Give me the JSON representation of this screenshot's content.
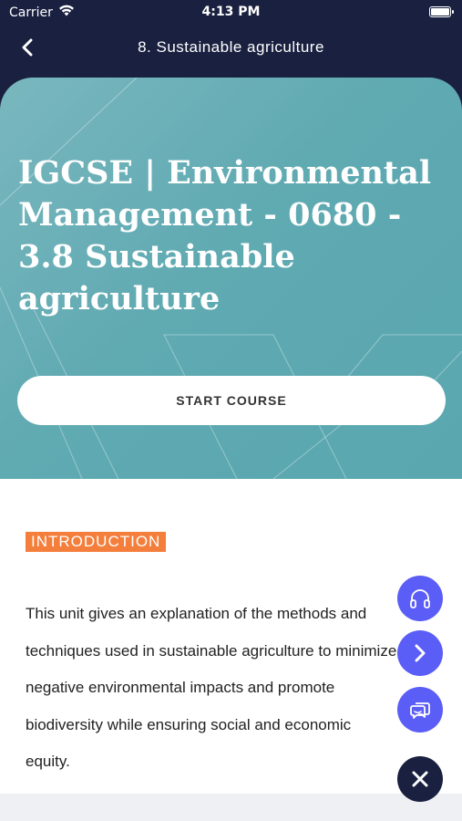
{
  "status_bar": {
    "carrier": "Carrier",
    "time": "4:13 PM"
  },
  "navbar": {
    "title": "8. Sustainable agriculture",
    "back_icon": "chevron-left-icon"
  },
  "hero": {
    "title": "IGCSE | Environmental Management - 0680 - 3.8 Sustainable agriculture",
    "start_button": "START COURSE"
  },
  "content": {
    "badge": "INTRODUCTION",
    "text": "This unit gives an explanation of the methods and techniques used in sustainable agriculture to minimize negative environmental impacts and promote biodiversity while ensuring social and economic equity."
  },
  "fabs": [
    {
      "icon": "headphones-icon"
    },
    {
      "icon": "chevron-right-icon"
    },
    {
      "icon": "chat-icon"
    },
    {
      "icon": "close-icon"
    }
  ],
  "colors": {
    "header_bg": "#1a2140",
    "hero_teal": "#60aab2",
    "badge_orange": "#f47e3c",
    "fab_blue": "#5b5ef6"
  }
}
